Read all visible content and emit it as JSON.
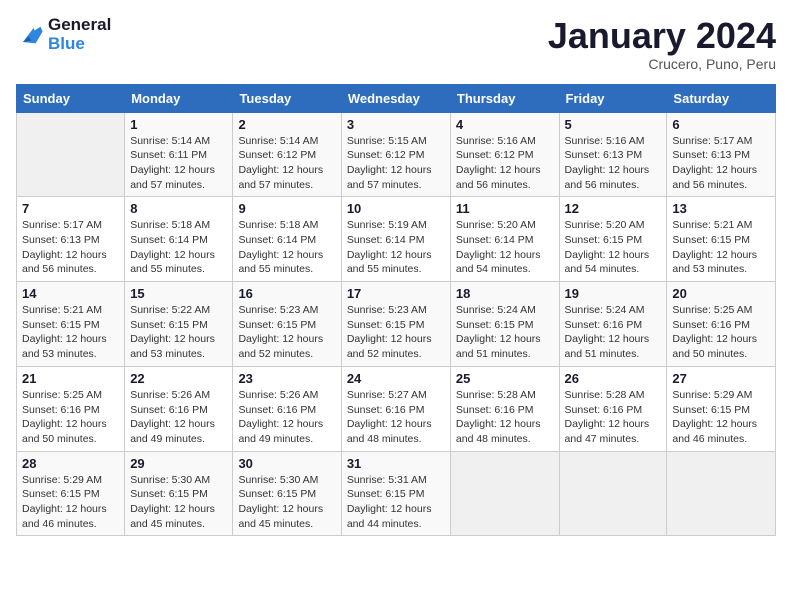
{
  "header": {
    "logo_line1": "General",
    "logo_line2": "Blue",
    "month": "January 2024",
    "location": "Crucero, Puno, Peru"
  },
  "weekdays": [
    "Sunday",
    "Monday",
    "Tuesday",
    "Wednesday",
    "Thursday",
    "Friday",
    "Saturday"
  ],
  "weeks": [
    [
      {
        "day": "",
        "info": ""
      },
      {
        "day": "1",
        "info": "Sunrise: 5:14 AM\nSunset: 6:11 PM\nDaylight: 12 hours\nand 57 minutes."
      },
      {
        "day": "2",
        "info": "Sunrise: 5:14 AM\nSunset: 6:12 PM\nDaylight: 12 hours\nand 57 minutes."
      },
      {
        "day": "3",
        "info": "Sunrise: 5:15 AM\nSunset: 6:12 PM\nDaylight: 12 hours\nand 57 minutes."
      },
      {
        "day": "4",
        "info": "Sunrise: 5:16 AM\nSunset: 6:12 PM\nDaylight: 12 hours\nand 56 minutes."
      },
      {
        "day": "5",
        "info": "Sunrise: 5:16 AM\nSunset: 6:13 PM\nDaylight: 12 hours\nand 56 minutes."
      },
      {
        "day": "6",
        "info": "Sunrise: 5:17 AM\nSunset: 6:13 PM\nDaylight: 12 hours\nand 56 minutes."
      }
    ],
    [
      {
        "day": "7",
        "info": "Sunrise: 5:17 AM\nSunset: 6:13 PM\nDaylight: 12 hours\nand 56 minutes."
      },
      {
        "day": "8",
        "info": "Sunrise: 5:18 AM\nSunset: 6:14 PM\nDaylight: 12 hours\nand 55 minutes."
      },
      {
        "day": "9",
        "info": "Sunrise: 5:18 AM\nSunset: 6:14 PM\nDaylight: 12 hours\nand 55 minutes."
      },
      {
        "day": "10",
        "info": "Sunrise: 5:19 AM\nSunset: 6:14 PM\nDaylight: 12 hours\nand 55 minutes."
      },
      {
        "day": "11",
        "info": "Sunrise: 5:20 AM\nSunset: 6:14 PM\nDaylight: 12 hours\nand 54 minutes."
      },
      {
        "day": "12",
        "info": "Sunrise: 5:20 AM\nSunset: 6:15 PM\nDaylight: 12 hours\nand 54 minutes."
      },
      {
        "day": "13",
        "info": "Sunrise: 5:21 AM\nSunset: 6:15 PM\nDaylight: 12 hours\nand 53 minutes."
      }
    ],
    [
      {
        "day": "14",
        "info": "Sunrise: 5:21 AM\nSunset: 6:15 PM\nDaylight: 12 hours\nand 53 minutes."
      },
      {
        "day": "15",
        "info": "Sunrise: 5:22 AM\nSunset: 6:15 PM\nDaylight: 12 hours\nand 53 minutes."
      },
      {
        "day": "16",
        "info": "Sunrise: 5:23 AM\nSunset: 6:15 PM\nDaylight: 12 hours\nand 52 minutes."
      },
      {
        "day": "17",
        "info": "Sunrise: 5:23 AM\nSunset: 6:15 PM\nDaylight: 12 hours\nand 52 minutes."
      },
      {
        "day": "18",
        "info": "Sunrise: 5:24 AM\nSunset: 6:15 PM\nDaylight: 12 hours\nand 51 minutes."
      },
      {
        "day": "19",
        "info": "Sunrise: 5:24 AM\nSunset: 6:16 PM\nDaylight: 12 hours\nand 51 minutes."
      },
      {
        "day": "20",
        "info": "Sunrise: 5:25 AM\nSunset: 6:16 PM\nDaylight: 12 hours\nand 50 minutes."
      }
    ],
    [
      {
        "day": "21",
        "info": "Sunrise: 5:25 AM\nSunset: 6:16 PM\nDaylight: 12 hours\nand 50 minutes."
      },
      {
        "day": "22",
        "info": "Sunrise: 5:26 AM\nSunset: 6:16 PM\nDaylight: 12 hours\nand 49 minutes."
      },
      {
        "day": "23",
        "info": "Sunrise: 5:26 AM\nSunset: 6:16 PM\nDaylight: 12 hours\nand 49 minutes."
      },
      {
        "day": "24",
        "info": "Sunrise: 5:27 AM\nSunset: 6:16 PM\nDaylight: 12 hours\nand 48 minutes."
      },
      {
        "day": "25",
        "info": "Sunrise: 5:28 AM\nSunset: 6:16 PM\nDaylight: 12 hours\nand 48 minutes."
      },
      {
        "day": "26",
        "info": "Sunrise: 5:28 AM\nSunset: 6:16 PM\nDaylight: 12 hours\nand 47 minutes."
      },
      {
        "day": "27",
        "info": "Sunrise: 5:29 AM\nSunset: 6:15 PM\nDaylight: 12 hours\nand 46 minutes."
      }
    ],
    [
      {
        "day": "28",
        "info": "Sunrise: 5:29 AM\nSunset: 6:15 PM\nDaylight: 12 hours\nand 46 minutes."
      },
      {
        "day": "29",
        "info": "Sunrise: 5:30 AM\nSunset: 6:15 PM\nDaylight: 12 hours\nand 45 minutes."
      },
      {
        "day": "30",
        "info": "Sunrise: 5:30 AM\nSunset: 6:15 PM\nDaylight: 12 hours\nand 45 minutes."
      },
      {
        "day": "31",
        "info": "Sunrise: 5:31 AM\nSunset: 6:15 PM\nDaylight: 12 hours\nand 44 minutes."
      },
      {
        "day": "",
        "info": ""
      },
      {
        "day": "",
        "info": ""
      },
      {
        "day": "",
        "info": ""
      }
    ]
  ]
}
